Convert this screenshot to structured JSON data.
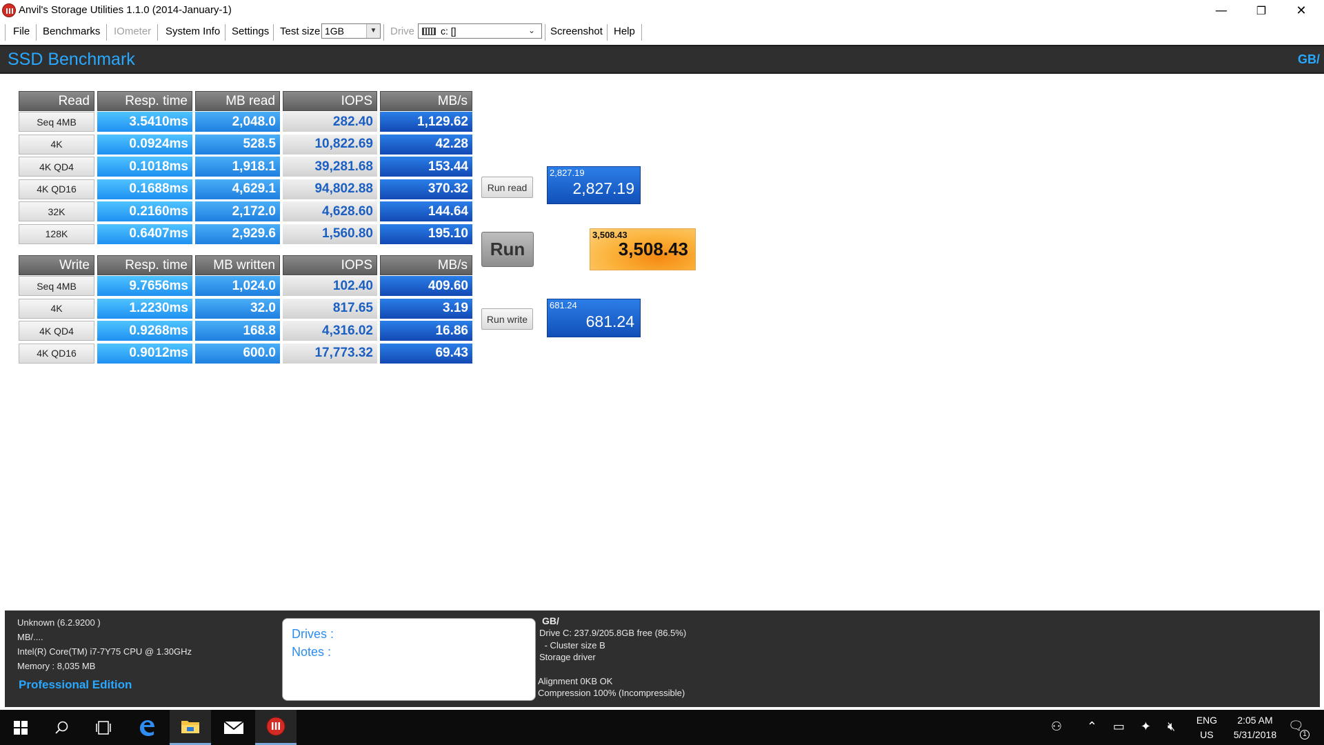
{
  "window": {
    "title": "Anvil's Storage Utilities 1.1.0 (2014-January-1)",
    "minimize": "—",
    "restore": "❐",
    "close": "✕"
  },
  "menu": {
    "file": "File",
    "benchmarks": "Benchmarks",
    "iometer": "IOmeter",
    "system_info": "System Info",
    "settings": "Settings",
    "test_size_label": "Test size",
    "test_size_value": "1GB",
    "drive_label": "Drive",
    "drive_value": "c: []",
    "screenshot": "Screenshot",
    "help": "Help"
  },
  "header": {
    "title": "SSD Benchmark",
    "right": "GB/"
  },
  "read": {
    "headers": [
      "Read",
      "Resp. time",
      "MB read",
      "IOPS",
      "MB/s"
    ],
    "rows": [
      {
        "label": "Seq 4MB",
        "resp": "3.5410ms",
        "mb": "2,048.0",
        "iops": "282.40",
        "mbs": "1,129.62"
      },
      {
        "label": "4K",
        "resp": "0.0924ms",
        "mb": "528.5",
        "iops": "10,822.69",
        "mbs": "42.28"
      },
      {
        "label": "4K QD4",
        "resp": "0.1018ms",
        "mb": "1,918.1",
        "iops": "39,281.68",
        "mbs": "153.44"
      },
      {
        "label": "4K QD16",
        "resp": "0.1688ms",
        "mb": "4,629.1",
        "iops": "94,802.88",
        "mbs": "370.32"
      },
      {
        "label": "32K",
        "resp": "0.2160ms",
        "mb": "2,172.0",
        "iops": "4,628.60",
        "mbs": "144.64"
      },
      {
        "label": "128K",
        "resp": "0.6407ms",
        "mb": "2,929.6",
        "iops": "1,560.80",
        "mbs": "195.10"
      }
    ]
  },
  "write": {
    "headers": [
      "Write",
      "Resp. time",
      "MB written",
      "IOPS",
      "MB/s"
    ],
    "rows": [
      {
        "label": "Seq 4MB",
        "resp": "9.7656ms",
        "mb": "1,024.0",
        "iops": "102.40",
        "mbs": "409.60"
      },
      {
        "label": "4K",
        "resp": "1.2230ms",
        "mb": "32.0",
        "iops": "817.65",
        "mbs": "3.19"
      },
      {
        "label": "4K QD4",
        "resp": "0.9268ms",
        "mb": "168.8",
        "iops": "4,316.02",
        "mbs": "16.86"
      },
      {
        "label": "4K QD16",
        "resp": "0.9012ms",
        "mb": "600.0",
        "iops": "17,773.32",
        "mbs": "69.43"
      }
    ]
  },
  "buttons": {
    "run_read": "Run read",
    "run": "Run",
    "run_write": "Run write"
  },
  "scores": {
    "read_small": "2,827.19",
    "read_big": "2,827.19",
    "total_small": "3,508.43",
    "total_big": "3,508.43",
    "write_small": "681.24",
    "write_big": "681.24"
  },
  "footer": {
    "os": "Unknown (6.2.9200 )",
    "mb": "MB/....",
    "cpu": "Intel(R) Core(TM) i7-7Y75 CPU @ 1.30GHz",
    "memory": "Memory : 8,035 MB",
    "edition": "Professional Edition",
    "drives_label": "Drives :",
    "notes_label": "Notes :",
    "gb_title": "GB/",
    "drive_info": "Drive C: 237.9/205.8GB free (86.5%)",
    "cluster": " - Cluster size B",
    "storage_driver": "Storage driver",
    "alignment": "Alignment 0KB OK",
    "compression": "Compression 100% (Incompressible)"
  },
  "taskbar": {
    "lang_top": "ENG",
    "lang_bottom": "US",
    "time": "2:05 AM",
    "date": "5/31/2018",
    "notification_count": "1"
  },
  "colors": {
    "header_bg": "#2f2f2f",
    "accent_blue": "#29a8ff",
    "score_orange": "#f58a12"
  }
}
